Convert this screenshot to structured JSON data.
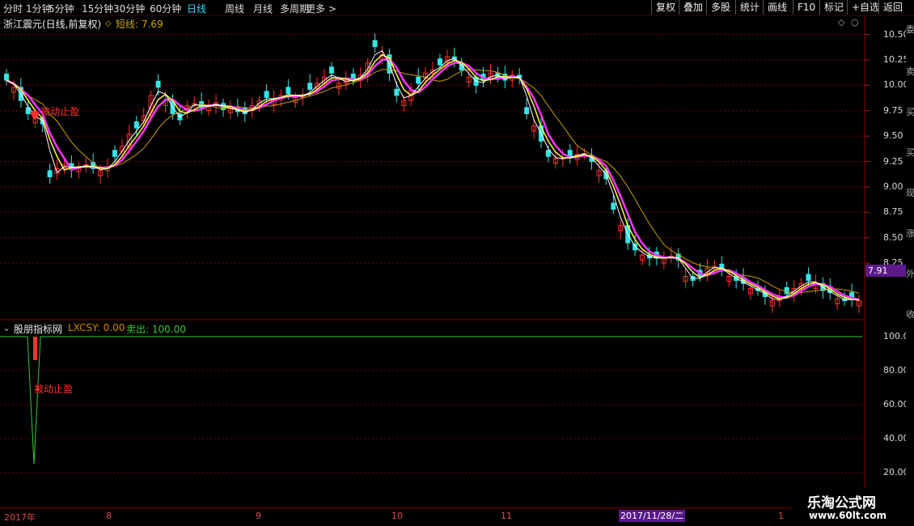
{
  "toolbar": {
    "periods": [
      "分时",
      "1分钟",
      "5分钟",
      "15分钟",
      "30分钟",
      "60分钟",
      "日线",
      "周线",
      "月线",
      "多周期",
      "更多 >"
    ],
    "active_period": "日线",
    "buttons": [
      "复权",
      "叠加",
      "多股",
      "统计",
      "画线",
      "F10",
      "标记",
      "+自选",
      "返回"
    ]
  },
  "main_chart": {
    "stock_title": "浙江震元(日线,前复权)",
    "ma_label": "短线: 7.69",
    "annotation": "被动止盈",
    "last_price": "7.91",
    "price_ticks": [
      "10.50",
      "10.25",
      "10.00",
      "9.75",
      "9.50",
      "9.25",
      "9.00",
      "8.75",
      "8.50",
      "8.25"
    ]
  },
  "indicator": {
    "name": "股朋指标网",
    "lxcsy_label": "LXCSY: 0.00",
    "sell_label": "卖出: 100.00",
    "annotation": "被动止盈",
    "ticks": [
      "100.0",
      "80.00",
      "60.00",
      "40.00",
      "20.00"
    ]
  },
  "date_axis": {
    "labels": [
      "2017年",
      "8",
      "9",
      "10",
      "11",
      "1"
    ],
    "cursor_date": "2017/11/28/二"
  },
  "watermark": {
    "title": "乐淘公式网",
    "url": "www.60lt.com"
  },
  "colors": {
    "up": "#ff3030",
    "down": "#33e6e6",
    "ma_yellow": "#ffff33",
    "ma_magenta": "#ff33ff",
    "ma_thin": "#c8a000",
    "grid": "#7a0000",
    "sell_line": "#33cc33"
  },
  "chart_data": {
    "type": "candlestick",
    "ylim": [
      7.75,
      10.6
    ],
    "close": [
      10.05,
      9.98,
      9.85,
      9.72,
      9.68,
      9.62,
      9.1,
      9.18,
      9.22,
      9.17,
      9.2,
      9.22,
      9.18,
      9.16,
      9.2,
      9.3,
      9.4,
      9.52,
      9.58,
      9.7,
      9.9,
      9.98,
      9.85,
      9.72,
      9.66,
      9.8,
      9.82,
      9.78,
      9.8,
      9.83,
      9.76,
      9.78,
      9.74,
      9.72,
      9.8,
      9.85,
      9.88,
      9.86,
      9.9,
      9.92,
      9.88,
      9.9,
      9.96,
      10.02,
      10.08,
      10.12,
      10.02,
      10.05,
      10.05,
      10.1,
      10.22,
      10.38,
      10.3,
      10.12,
      9.9,
      9.85,
      9.95,
      10.02,
      10.12,
      10.15,
      10.2,
      10.28,
      10.25,
      10.15,
      10.08,
      10.0,
      10.05,
      10.12,
      10.08,
      10.05,
      10.1,
      10.07,
      9.72,
      9.6,
      9.45,
      9.3,
      9.28,
      9.28,
      9.3,
      9.32,
      9.33,
      9.25,
      9.16,
      9.08,
      8.78,
      8.62,
      8.45,
      8.38,
      8.33,
      8.3,
      8.3,
      8.3,
      8.32,
      8.28,
      8.12,
      8.08,
      8.12,
      8.2,
      8.22,
      8.18,
      8.12,
      8.08,
      8.05,
      8.0,
      7.98,
      7.92,
      7.88,
      7.9,
      7.95,
      8.0,
      8.05,
      8.08,
      8.05,
      7.98,
      7.96,
      7.9,
      7.88,
      7.9,
      7.88
    ]
  }
}
